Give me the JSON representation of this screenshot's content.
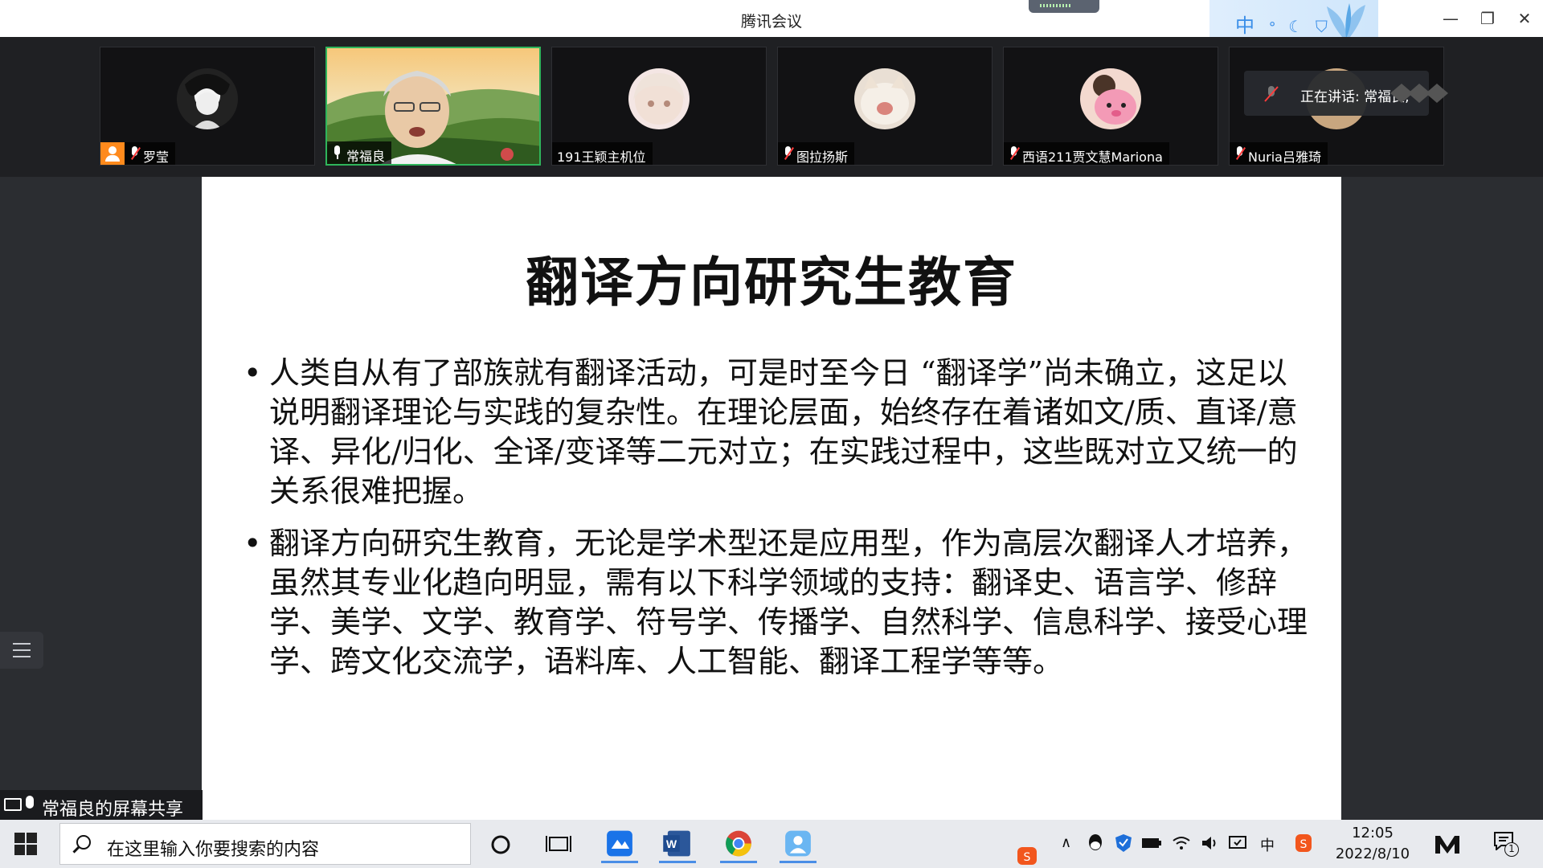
{
  "window": {
    "title": "腾讯会议",
    "ime_label": "中"
  },
  "participants": [
    {
      "name": "罗莹",
      "mic": "muted",
      "badge": "host"
    },
    {
      "name": "常福良",
      "mic": "on",
      "active": true
    },
    {
      "name": "191王颖主机位",
      "mic": "none"
    },
    {
      "name": "图拉扬斯",
      "mic": "muted"
    },
    {
      "name": "西语211贾文慧Mariona",
      "mic": "muted"
    },
    {
      "name": "Nuria吕雅琦",
      "mic": "muted"
    }
  ],
  "speaking_now": "正在讲话: 常福良;",
  "slide": {
    "title": "翻译方向研究生教育",
    "bullets": [
      "人类自从有了部族就有翻译活动，可是时至今日 “翻译学”尚未确立，这足以说明翻译理论与实践的复杂性。在理论层面，始终存在着诸如文/质、直译/意译、异化/归化、全译/变译等二元对立；在实践过程中，这些既对立又统一的关系很难把握。",
      "翻译方向研究生教育，无论是学术型还是应用型，作为高层次翻译人才培养，虽然其专业化趋向明显，需有以下科学领域的支持：翻译史、语言学、修辞学、美学、文学、教育学、符号学、传播学、自然科学、信息科学、接受心理学、跨文化交流学，语料库、人工智能、翻译工程学等等。"
    ]
  },
  "share_label": "常福良的屏幕共享",
  "taskbar": {
    "search_placeholder": "在这里输入你要搜索的内容",
    "tray_ime": "中",
    "time": "12:05",
    "date": "2022/8/10",
    "notification_count": "1"
  }
}
